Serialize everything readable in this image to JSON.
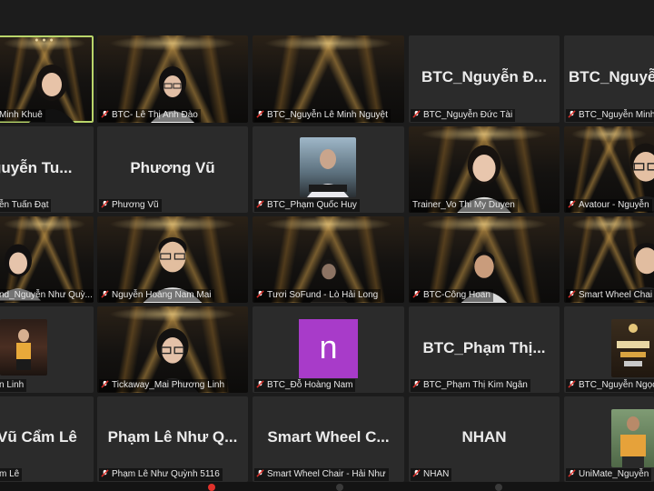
{
  "tiles": [
    {
      "id": "t1",
      "kind": "video",
      "label": "Minh Khuê",
      "muted": false,
      "active": true
    },
    {
      "id": "t2",
      "kind": "video",
      "label": "BTC- Lê Thị Anh Đào",
      "muted": true
    },
    {
      "id": "t3",
      "kind": "video",
      "label": "BTC_Nguyễn Lê Minh Nguyệt",
      "muted": true
    },
    {
      "id": "t4",
      "kind": "name",
      "display": "BTC_Nguyễn Đ...",
      "label": "BTC_Nguyễn Đức Tài",
      "muted": true
    },
    {
      "id": "t5",
      "kind": "name",
      "display": "BTC_Nguyễ",
      "label": "BTC_Nguyễn Minh",
      "muted": true
    },
    {
      "id": "t6",
      "kind": "name",
      "display": "guyễn Tu...",
      "label": "ễn Tuấn Đạt",
      "muted": false
    },
    {
      "id": "t7",
      "kind": "name",
      "display": "Phương Vũ",
      "label": "Phương Vũ",
      "muted": true
    },
    {
      "id": "t8",
      "kind": "photo",
      "label": "BTC_Phạm Quốc Huy",
      "muted": true
    },
    {
      "id": "t9",
      "kind": "video",
      "label": "Trainer_Vo Thi My Duyen",
      "muted": false
    },
    {
      "id": "t10",
      "kind": "video",
      "label": "Avatour - Nguyễn",
      "muted": true
    },
    {
      "id": "t11",
      "kind": "video",
      "label": "nd_Nguyễn Như Quỳ...",
      "muted": false
    },
    {
      "id": "t12",
      "kind": "video",
      "label": "Nguyễn Hoàng Nam Mai",
      "muted": true
    },
    {
      "id": "t13",
      "kind": "video",
      "label": "Tươi SoFund - Lò Hải Long",
      "muted": true
    },
    {
      "id": "t14",
      "kind": "video",
      "label": "BTC-Công Hoan",
      "muted": true
    },
    {
      "id": "t15",
      "kind": "video",
      "label": "Smart Wheel Chai",
      "muted": true
    },
    {
      "id": "t16",
      "kind": "photo",
      "label": "n Linh",
      "muted": false
    },
    {
      "id": "t17",
      "kind": "video",
      "label": "Tickaway_Mai Phương Linh",
      "muted": true
    },
    {
      "id": "t18",
      "kind": "avatar",
      "letter": "n",
      "label": "BTC_Đỗ Hoàng Nam",
      "muted": true
    },
    {
      "id": "t19",
      "kind": "name",
      "display": "BTC_Phạm Thị...",
      "label": "BTC_Phạm Thị Kim Ngân",
      "muted": true
    },
    {
      "id": "t20",
      "kind": "photo",
      "label": "BTC_Nguyễn Ngọc",
      "muted": true
    },
    {
      "id": "t21",
      "kind": "name",
      "display": "Vũ Cẩm Lê",
      "label": "m Lê",
      "muted": false
    },
    {
      "id": "t22",
      "kind": "name",
      "display": "Phạm Lê Như Q...",
      "label": "Phạm Lê Như Quỳnh 5116",
      "muted": true
    },
    {
      "id": "t23",
      "kind": "name",
      "display": "Smart Wheel C...",
      "label": "Smart Wheel Chair - Hải Như",
      "muted": true
    },
    {
      "id": "t24",
      "kind": "name",
      "display": "NHAN",
      "label": "NHAN",
      "muted": true
    },
    {
      "id": "t25",
      "kind": "photo",
      "label": "UniMate_Nguyễn",
      "muted": true
    }
  ],
  "colors": {
    "muted": "#e0312b",
    "active_border": "#b9d56a",
    "avatar": "#a83bc9"
  }
}
